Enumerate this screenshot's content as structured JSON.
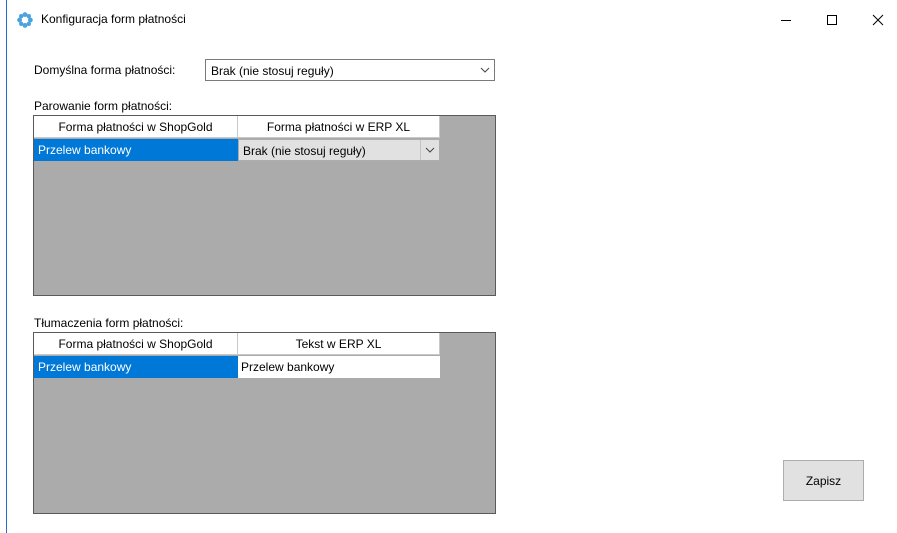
{
  "window": {
    "title": "Konfiguracja form płatności",
    "app_icon": "gear-flower-icon",
    "controls": [
      "minimize-icon",
      "maximize-icon",
      "close-icon"
    ]
  },
  "default_payment": {
    "label": "Domyślna forma płatności:",
    "value": "Brak (nie stosuj reguły)"
  },
  "pairing": {
    "label": "Parowanie form płatności:",
    "columns": [
      "Forma płatności w ShopGold",
      "Forma płatności w ERP XL"
    ],
    "rows": [
      {
        "shop": "Przelew bankowy",
        "erp": "Brak (nie stosuj reguły)"
      }
    ]
  },
  "translations": {
    "label": "Tłumaczenia form płatności:",
    "columns": [
      "Forma płatności w ShopGold",
      "Tekst w ERP XL"
    ],
    "rows": [
      {
        "shop": "Przelew bankowy",
        "text": "Przelew bankowy"
      }
    ]
  },
  "actions": {
    "save_label": "Zapisz"
  },
  "colors": {
    "selection": "#0078d7",
    "grid_bg": "#ababab",
    "window_border": "#1f6fd6"
  }
}
